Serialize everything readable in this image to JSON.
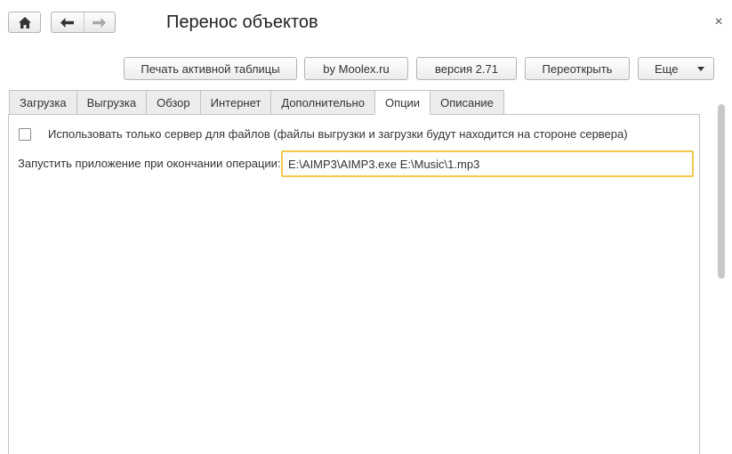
{
  "window": {
    "title": "Перенос объектов",
    "close_glyph": "×"
  },
  "nav": {
    "home_icon": "home-icon",
    "back_icon": "arrow-left-icon",
    "forward_icon": "arrow-right-icon"
  },
  "toolbar": {
    "print_label": "Печать активной таблицы",
    "by_label": "by Moolex.ru",
    "version_label": "версия 2.71",
    "reopen_label": "Переоткрыть",
    "more_label": "Еще"
  },
  "tabs": [
    {
      "label": "Загрузка",
      "active": false
    },
    {
      "label": "Выгрузка",
      "active": false
    },
    {
      "label": "Обзор",
      "active": false
    },
    {
      "label": "Интернет",
      "active": false
    },
    {
      "label": "Дополнительно",
      "active": false
    },
    {
      "label": "Опции",
      "active": true
    },
    {
      "label": "Описание",
      "active": false
    }
  ],
  "options": {
    "server_checkbox_label": "Использовать только сервер для файлов (файлы выгрузки и загрузки будут находится на стороне сервера)",
    "server_checkbox_checked": false,
    "run_app_label": "Запустить приложение при окончании операции:",
    "run_app_value": "E:\\AIMP3\\AIMP3.exe E:\\Music\\1.mp3"
  },
  "colors": {
    "active_field_border": "#f2c94c",
    "tab_inactive_bg": "#ececec"
  }
}
